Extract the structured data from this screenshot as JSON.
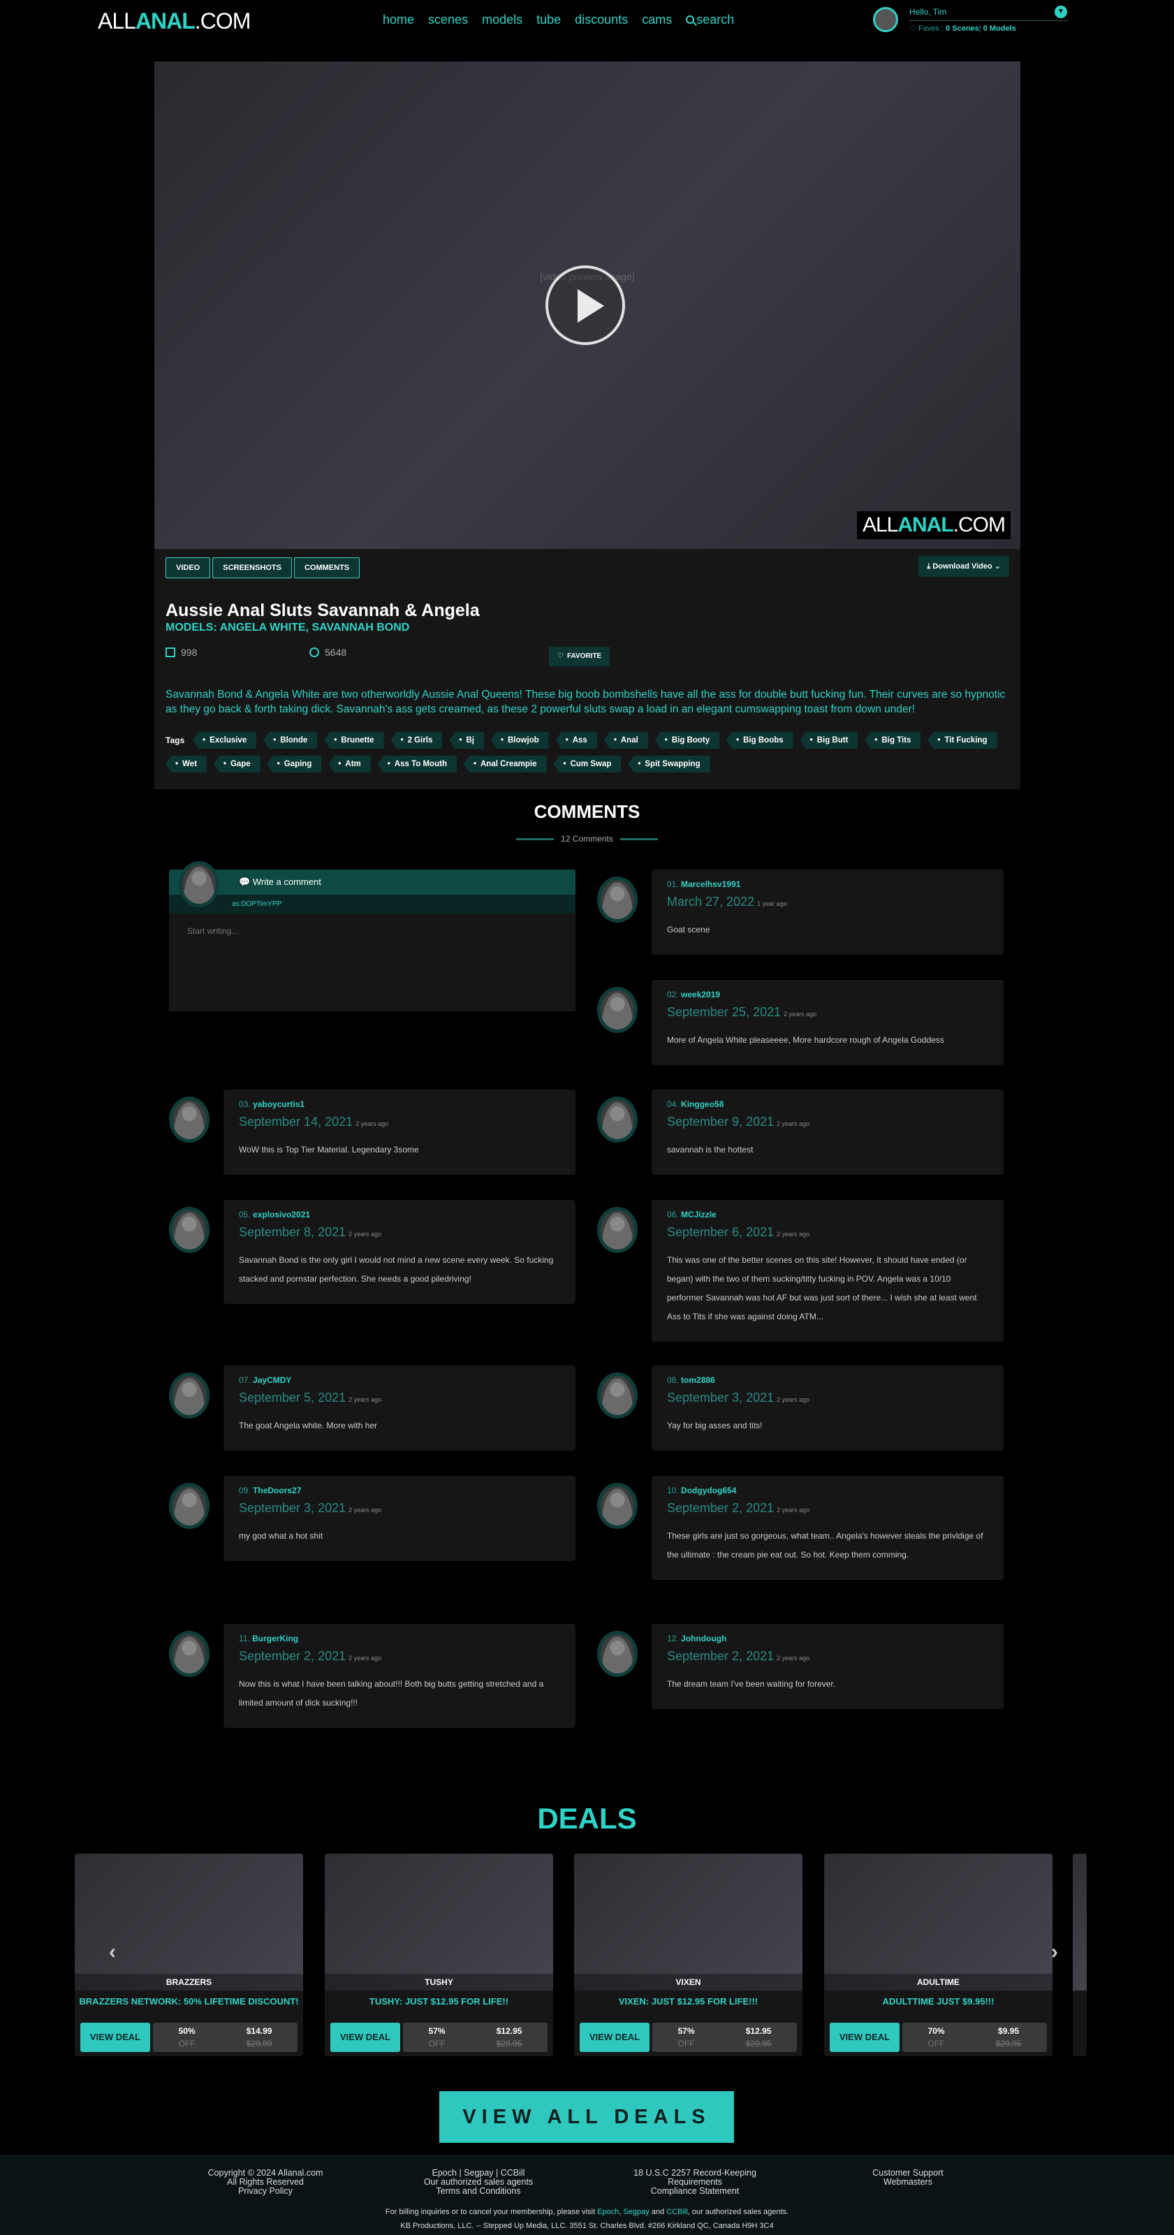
{
  "header": {
    "logo_prefix": "ALL",
    "logo_accent": "ANAL",
    "logo_suffix": ".COM",
    "nav": [
      "home",
      "scenes",
      "models",
      "tube",
      "discounts",
      "cams",
      "search"
    ],
    "user": {
      "greeting": "Hello, Tim",
      "faves_label": "Faves :",
      "faves_scenes": "0 Scenes",
      "faves_models": "0 Models"
    }
  },
  "video": {
    "placeholder": "[video preview image]",
    "watermark_prefix": "ALL",
    "watermark_accent": "ANAL",
    "watermark_suffix": ".COM",
    "tabs": [
      "VIDEO",
      "SCREENSHOTS",
      "COMMENTS"
    ],
    "download_label": "Download Video",
    "title": "Aussie Anal Sluts Savannah & Angela",
    "models_label": "MODELS: ANGELA WHITE, SAVANNAH BOND",
    "photo_count": "998",
    "view_count": "5648",
    "favorite_label": "FAVORITE",
    "description": "Savannah Bond & Angela White are two otherworldly Aussie Anal Queens! These big boob bombshells have all the ass for double butt fucking fun. Their curves are so hypnotic as they go back & forth taking dick. Savannah's ass gets creamed, as these 2 powerful sluts swap a load in an elegant cumswapping toast from down under!",
    "tags_label": "Tags",
    "tags": [
      "Exclusive",
      "Blonde",
      "Brunette",
      "2 Girls",
      "Bj",
      "Blowjob",
      "Ass",
      "Anal",
      "Big Booty",
      "Big Boobs",
      "Big Butt",
      "Big Tits",
      "Tit Fucking",
      "Wet",
      "Gape",
      "Gaping",
      "Atm",
      "Ass To Mouth",
      "Anal Creampie",
      "Cum Swap",
      "Spit Swapping"
    ]
  },
  "comments": {
    "title": "COMMENTS",
    "count_label": "12 Comments",
    "write": {
      "heading": "Write a comment",
      "as_user": "as:DOPTimYPP",
      "placeholder": "Start writing..."
    },
    "items": [
      {
        "num": "01.",
        "user": "Marcelhsv1991",
        "date": "March 27, 2022",
        "ago": "1 year ago",
        "text": "Goat scene"
      },
      {
        "num": "02.",
        "user": "week2019",
        "date": "September 25, 2021",
        "ago": "2 years ago",
        "text": "More of Angela White pleaseeee, More hardcore rough of Angela Goddess"
      },
      {
        "num": "03.",
        "user": "yaboycurtis1",
        "date": "September 14, 2021",
        "ago": "2 years ago",
        "text": "WoW this is Top Tier Material. Legendary 3some"
      },
      {
        "num": "04.",
        "user": "Kinggeo58",
        "date": "September 9, 2021",
        "ago": "2 years ago",
        "text": "savannah is the hottest"
      },
      {
        "num": "05.",
        "user": "explosivo2021",
        "date": "September 8, 2021",
        "ago": "2 years ago",
        "text": "Savannah Bond is the only girl I would not mind a new scene every week. So fucking stacked and pornstar perfection. She needs a good piledriving!"
      },
      {
        "num": "06.",
        "user": "MCJizzle",
        "date": "September 6, 2021",
        "ago": "2 years ago",
        "text": "This was one of the better scenes on this site! However, It should have ended (or began) with the two of them sucking/titty fucking in POV. Angela was a 10/10 performer Savannah was hot AF but was just sort of there... I wish she at least went Ass to Tits if she was against doing ATM..."
      },
      {
        "num": "07.",
        "user": "JayCMDY",
        "date": "September 5, 2021",
        "ago": "2 years ago",
        "text": "The goat Angela white. More with her"
      },
      {
        "num": "08.",
        "user": "tom2886",
        "date": "September 3, 2021",
        "ago": "2 years ago",
        "text": "Yay for big asses and tits!"
      },
      {
        "num": "09.",
        "user": "TheDoors27",
        "date": "September 3, 2021",
        "ago": "2 years ago",
        "text": "my god what a hot shit"
      },
      {
        "num": "10.",
        "user": "Dodgydog654",
        "date": "September 2, 2021",
        "ago": "2 years ago",
        "text": "These girls are just so gorgeous, what team.. Angela's however steals the privldige of the ultimate : the cream pie eat out. So hot. Keep them comming."
      },
      {
        "num": "11.",
        "user": "BurgerKing",
        "date": "September 2, 2021",
        "ago": "2 years ago",
        "text": "Now this is what I have been talking about!!! Both big butts getting stretched and a limited amount of dick sucking!!!"
      },
      {
        "num": "12.",
        "user": "Johndough",
        "date": "September 2, 2021",
        "ago": "2 years ago",
        "text": "The dream team I've been waiting for forever."
      }
    ]
  },
  "deals": {
    "title": "DEALS",
    "view_deal_label": "VIEW DEAL",
    "off_label": "OFF",
    "items": [
      {
        "brand": "BRAZZERS",
        "headline": "BRAZZERS NETWORK: 50% LIFETIME DISCOUNT!",
        "discount": "50%",
        "price": "$14.99",
        "old_price": "$29.99"
      },
      {
        "brand": "TUSHY",
        "headline": "TUSHY: JUST $12.95 FOR LIFE!!",
        "discount": "57%",
        "price": "$12.95",
        "old_price": "$29.95"
      },
      {
        "brand": "VIXEN",
        "headline": "VIXEN: JUST $12.95 FOR LIFE!!!",
        "discount": "57%",
        "price": "$12.95",
        "old_price": "$29.95"
      },
      {
        "brand": "ADULTIME",
        "headline": "ADULTTIME JUST $9.95!!!",
        "discount": "70%",
        "price": "$9.95",
        "old_price": "$29.95"
      }
    ],
    "view_all_label": "VIEW ALL DEALS"
  },
  "footer": {
    "col1": [
      "Copyright © 2024 Allanal.com",
      "All Rights Reserved",
      "Privacy Policy"
    ],
    "col2": [
      "Epoch | Segpay | CCBill",
      "Our authorized sales agents",
      "Terms and Conditions"
    ],
    "col3": [
      "18 U.S.C 2257 Record-Keeping",
      "Requirements",
      "Compliance Statement"
    ],
    "col4": [
      "Customer Support",
      "Webmasters"
    ],
    "billing_prefix": "For billing inquiries or to cancel your membership, please visit",
    "billing_links": [
      "Epoch",
      "Segpay",
      "CCBill"
    ],
    "billing_suffix": ", our authorized sales agents.",
    "address": "KB Productions, LLC. -- Stepped Up Media, LLC. 3551 St. Charles Blvd. #266 Kirkland QC, Canada H9H 3C4"
  },
  "colors": {
    "accent": "#2fd3c6",
    "accent_dark": "#0d3632",
    "background": "#000000",
    "card": "#161616"
  }
}
